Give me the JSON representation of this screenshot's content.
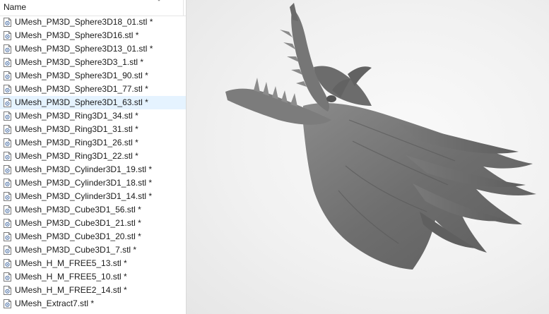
{
  "file_list": {
    "column_header": "Name",
    "files": [
      {
        "name": "UMesh_PM3D_Sphere3D18_01.stl *",
        "selected": false
      },
      {
        "name": "UMesh_PM3D_Sphere3D16.stl *",
        "selected": false
      },
      {
        "name": "UMesh_PM3D_Sphere3D13_01.stl *",
        "selected": false
      },
      {
        "name": "UMesh_PM3D_Sphere3D3_1.stl *",
        "selected": false
      },
      {
        "name": "UMesh_PM3D_Sphere3D1_90.stl *",
        "selected": false
      },
      {
        "name": "UMesh_PM3D_Sphere3D1_77.stl *",
        "selected": false
      },
      {
        "name": "UMesh_PM3D_Sphere3D1_63.stl *",
        "selected": true
      },
      {
        "name": "UMesh_PM3D_Ring3D1_34.stl *",
        "selected": false
      },
      {
        "name": "UMesh_PM3D_Ring3D1_31.stl *",
        "selected": false
      },
      {
        "name": "UMesh_PM3D_Ring3D1_26.stl *",
        "selected": false
      },
      {
        "name": "UMesh_PM3D_Ring3D1_22.stl *",
        "selected": false
      },
      {
        "name": "UMesh_PM3D_Cylinder3D1_19.stl *",
        "selected": false
      },
      {
        "name": "UMesh_PM3D_Cylinder3D1_18.stl *",
        "selected": false
      },
      {
        "name": "UMesh_PM3D_Cylinder3D1_14.stl *",
        "selected": false
      },
      {
        "name": "UMesh_PM3D_Cube3D1_56.stl *",
        "selected": false
      },
      {
        "name": "UMesh_PM3D_Cube3D1_21.stl *",
        "selected": false
      },
      {
        "name": "UMesh_PM3D_Cube3D1_20.stl *",
        "selected": false
      },
      {
        "name": "UMesh_PM3D_Cube3D1_7.stl *",
        "selected": false
      },
      {
        "name": "UMesh_H_M_FREE5_13.stl *",
        "selected": false
      },
      {
        "name": "UMesh_H_M_FREE5_10.stl *",
        "selected": false
      },
      {
        "name": "UMesh_H_M_FREE2_14.stl *",
        "selected": false
      },
      {
        "name": "UMesh_Extract7.stl *",
        "selected": false
      }
    ]
  },
  "viewport": {
    "model_icon": "dragon-head-model",
    "model_color": "#707070",
    "background_color": "#f1f1f1"
  },
  "colors": {
    "selection": "#e5f3ff",
    "text": "#1a1a1a",
    "divider": "#d9d9d9"
  }
}
